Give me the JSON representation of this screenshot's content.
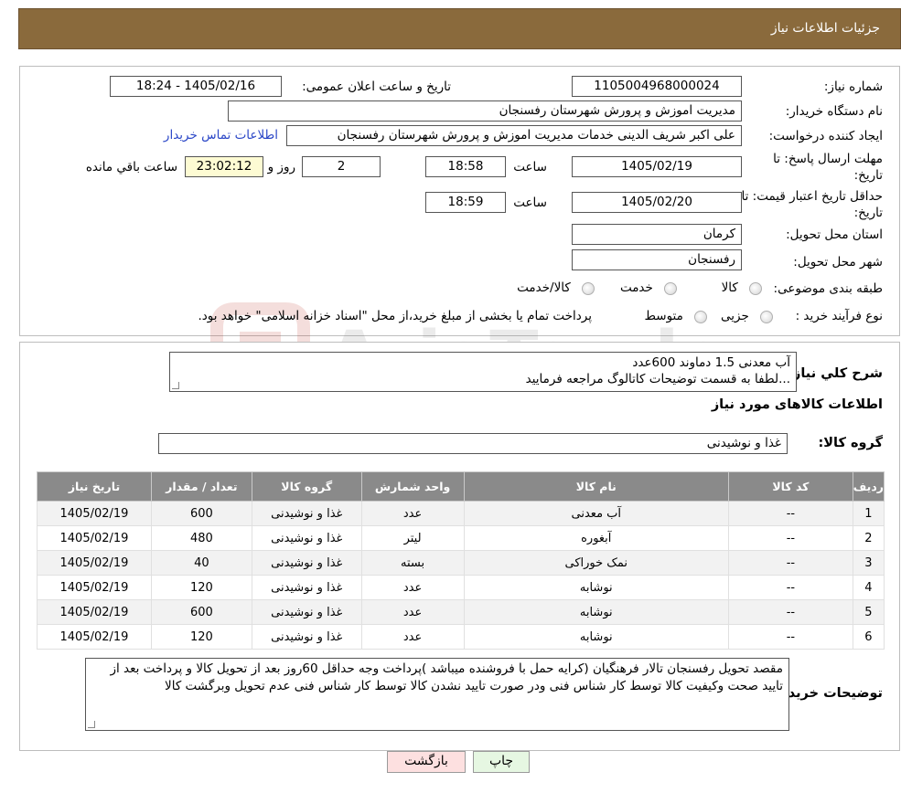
{
  "header": {
    "title": "جزئیات اطلاعات نیاز"
  },
  "watermark": {
    "text": "AriaTender.neT"
  },
  "need": {
    "number_label": "شماره نیاز:",
    "number": "1105004968000024",
    "announce_label": "تاریخ و ساعت اعلان عمومی:",
    "announce": "1405/02/16 - 18:24",
    "buyer_org_label": "نام دستگاه خریدار:",
    "buyer_org": "مدیریت اموزش و پرورش شهرستان رفسنجان",
    "requester_label": "ایجاد کننده درخواست:",
    "requester": "علی اکبر شریف الدینی خدمات مدیریت اموزش و پرورش شهرستان رفسنجان",
    "contact_link": "اطلاعات تماس خریدار",
    "deadline_label_1": "مهلت ارسال پاسخ: تا",
    "deadline_label_2": "تاریخ:",
    "deadline_date": "1405/02/19",
    "time_word": "ساعت",
    "deadline_time": "18:58",
    "days": "2",
    "days_word": "روز و",
    "remaining": "23:02:12",
    "remaining_word": "ساعت باقي مانده",
    "validity_label_1": "حداقل تاریخ اعتبار قیمت: تا",
    "validity_label_2": "تاریخ:",
    "validity_date": "1405/02/20",
    "validity_time": "18:59",
    "province_label": "استان محل تحویل:",
    "province": "کرمان",
    "city_label": "شهر محل تحویل:",
    "city": "رفسنجان",
    "category_label": "طبقه بندی موضوعی:",
    "category_options": [
      "کالا",
      "خدمت",
      "کالا/خدمت"
    ],
    "process_label": "نوع فرآیند خرید :",
    "process_options": [
      "جزیی",
      "متوسط"
    ],
    "process_note": "پرداخت تمام یا بخشی از مبلغ خرید،از محل \"اسناد خزانه اسلامی\" خواهد بود."
  },
  "summary": {
    "label": "شرح کلي نياز:",
    "line1": "آب معدنی 1.5 دماوند 600عدد",
    "line2": "...لطفا به قسمت توضیحات کاتالوگ مراجعه فرمایید"
  },
  "goods": {
    "section_title": "اطلاعات کالاهای مورد نیاز",
    "group_label": "گروه کالا:",
    "group_value": "غذا و نوشیدنی",
    "columns": [
      "رديف",
      "کد کالا",
      "نام کالا",
      "واحد شمارش",
      "گروه کالا",
      "تعداد / مقدار",
      "تاریخ نیاز"
    ],
    "rows": [
      [
        "1",
        "--",
        "آب معدنی",
        "عدد",
        "غذا و نوشیدنی",
        "600",
        "1405/02/19"
      ],
      [
        "2",
        "--",
        "آبغوره",
        "لیتر",
        "غذا و نوشیدنی",
        "480",
        "1405/02/19"
      ],
      [
        "3",
        "--",
        "نمک خوراکی",
        "بسته",
        "غذا و نوشیدنی",
        "40",
        "1405/02/19"
      ],
      [
        "4",
        "--",
        "نوشابه",
        "عدد",
        "غذا و نوشیدنی",
        "120",
        "1405/02/19"
      ],
      [
        "5",
        "--",
        "نوشابه",
        "عدد",
        "غذا و نوشیدنی",
        "600",
        "1405/02/19"
      ],
      [
        "6",
        "--",
        "نوشابه",
        "عدد",
        "غذا و نوشیدنی",
        "120",
        "1405/02/19"
      ]
    ]
  },
  "buyer_notes": {
    "label": "توضیحات خریدار:",
    "text": "مقصد تحویل رفسنجان تالار فرهنگیان (کرایه حمل با فروشنده میباشد )پرداخت وجه حداقل 60روز بعد از تحویل کالا و پرداخت بعد از تایید صحت وکیفیت کالا توسط کار شناس فنی ودر صورت تایید نشدن کالا توسط کار شناس فنی عدم تحویل وبرگشت کالا"
  },
  "buttons": {
    "print": "چاپ",
    "back": "بازگشت"
  },
  "colors": {
    "header_bg": "#8a6a3c",
    "table_header_bg": "#8a8a8a",
    "remaining_bg": "#fdfbd3",
    "back_button_bg": "#fde0e0",
    "print_button_bg": "#e6f7e2",
    "link": "#2b47c7"
  }
}
